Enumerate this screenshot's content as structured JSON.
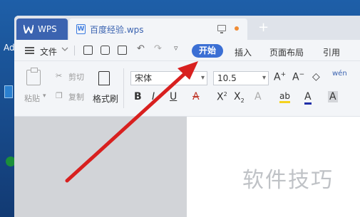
{
  "desktop": {
    "label": "Ad"
  },
  "tabs": {
    "app_label": "WPS",
    "doc_label": "百度经验.wps",
    "doc_icon_letter": "W",
    "new_tab": "+"
  },
  "menubar": {
    "file_label": "文件",
    "active_tab": "开始",
    "tabs": [
      "插入",
      "页面布局",
      "引用"
    ]
  },
  "ribbon": {
    "paste_label": "粘贴",
    "cut_label": "剪切",
    "copy_label": "复制",
    "format_painter_label": "格式刷",
    "font_name": "宋体",
    "font_size": "10.5",
    "bold": "B",
    "italic": "I",
    "underline": "U",
    "phonetic": "wén"
  },
  "watermark": "软件技巧",
  "colors": {
    "accent": "#3b6fd4",
    "arrow": "#d8201f",
    "app_tab": "#3b63b0"
  }
}
